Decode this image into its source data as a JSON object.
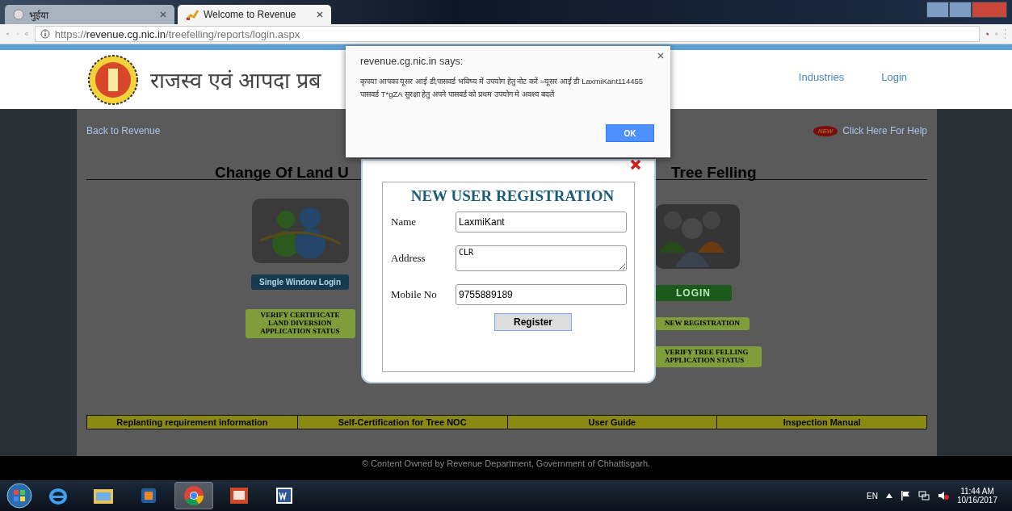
{
  "browser": {
    "tabs": [
      {
        "title": "भुईया",
        "selected": false
      },
      {
        "title": "Welcome to Revenue",
        "selected": true
      }
    ],
    "url": {
      "scheme": "https://",
      "host": "revenue.cg.nic.in",
      "path": "/treefelling/reports/login.aspx"
    }
  },
  "header": {
    "title": "राजस्व एवं आपदा प्रब",
    "nav": [
      "Industries",
      "Login"
    ]
  },
  "links": {
    "back": "Back to Revenue",
    "help_badge": "NEW",
    "help": "Click Here For Help"
  },
  "sections": [
    {
      "title": "Change Of Land U",
      "buttons": [
        {
          "label": "Single Window Login",
          "kind": "blue"
        },
        {
          "label": "VERIFY CERTIFICATE LAND DIVERSION APPLICATION STATUS",
          "kind": "green"
        }
      ]
    },
    {
      "title": "Tree Felling",
      "buttons": [
        {
          "label": "LOGIN",
          "kind": "login"
        },
        {
          "label": "NEW REGISTRATION",
          "kind": "green"
        },
        {
          "label": "VERIFY TREE FELLING APPLICATION STATUS",
          "kind": "green"
        }
      ]
    }
  ],
  "bottom_links": [
    "Replanting requirement information",
    "Self-Certification for Tree NOC",
    "User Guide",
    "Inspection Manual"
  ],
  "footer": "© Content Owned by Revenue Department, Government of Chhattisgarh.",
  "alert": {
    "title": "revenue.cg.nic.in says:",
    "message": "कृपया आपका यूसर आई डी,पासवर्ड भविष्य में उपयोग हेतु नोट करें =यूसर आई डी LaxmiKant114455 पासवर्ड T*gZA सुरक्षा हेतु अपने पासवर्ड को प्रथम उपयोग मे अवश्य बदलें",
    "ok": "OK"
  },
  "modal": {
    "title": "NEW USER REGISTRATION",
    "fields": [
      {
        "label": "Name",
        "value": "LaxmiKant",
        "kind": "input"
      },
      {
        "label": "Address",
        "value": "CLR",
        "kind": "textarea"
      },
      {
        "label": "Mobile No",
        "value": "9755889189",
        "kind": "input"
      }
    ],
    "submit": "Register"
  },
  "taskbar": {
    "apps": [
      {
        "kind": "ie",
        "selected": false
      },
      {
        "kind": "explorer",
        "selected": false
      },
      {
        "kind": "media",
        "selected": false
      },
      {
        "kind": "chrome",
        "selected": true
      },
      {
        "kind": "slides",
        "selected": false
      },
      {
        "kind": "word",
        "selected": false
      }
    ],
    "language": "EN",
    "time": "11:44 AM",
    "date": "10/16/2017"
  }
}
